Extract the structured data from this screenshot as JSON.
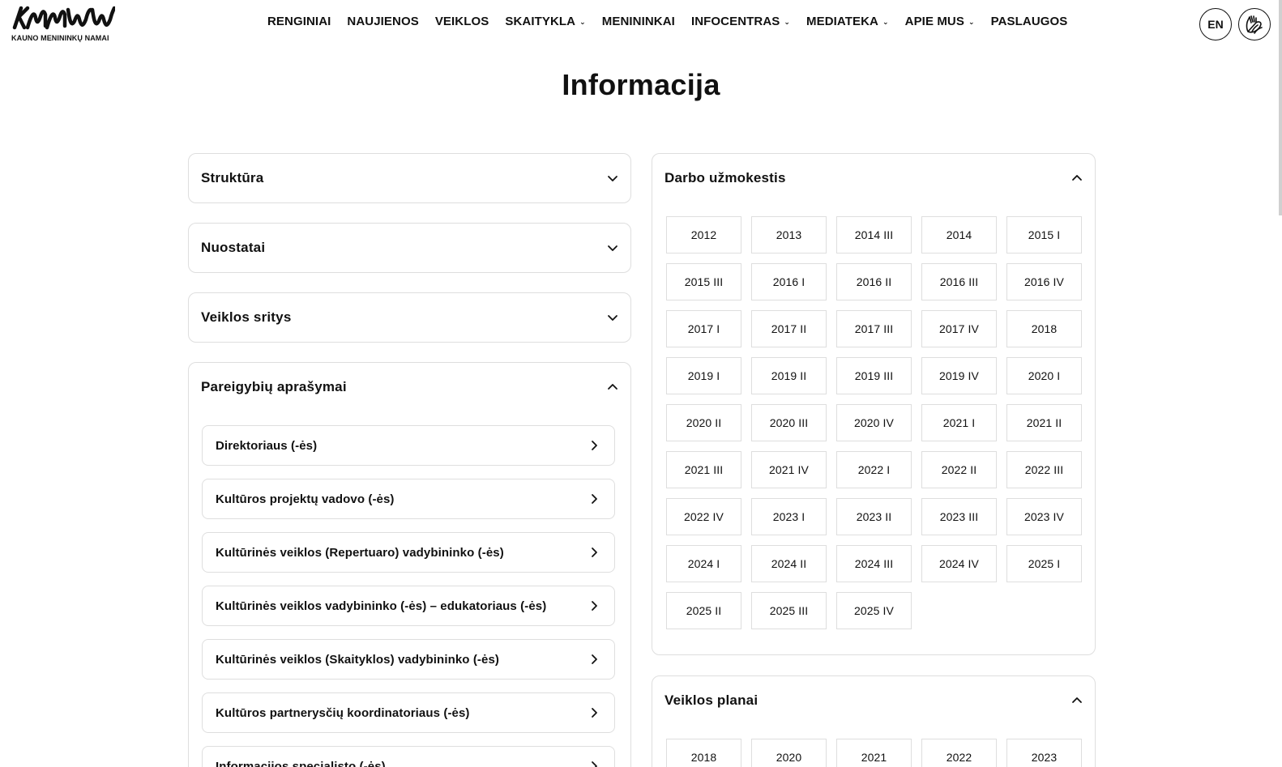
{
  "brand": {
    "logo_text": "KAUNO MENININKŲ NAMAI"
  },
  "nav": [
    {
      "label": "RENGINIAI",
      "dropdown": false
    },
    {
      "label": "NAUJIENOS",
      "dropdown": false
    },
    {
      "label": "VEIKLOS",
      "dropdown": false
    },
    {
      "label": "SKAITYKLA",
      "dropdown": true
    },
    {
      "label": "MENININKAI",
      "dropdown": false
    },
    {
      "label": "INFOCENTRAS",
      "dropdown": true
    },
    {
      "label": "MEDIATEKA",
      "dropdown": true
    },
    {
      "label": "APIE MUS",
      "dropdown": true
    },
    {
      "label": "PASLAUGOS",
      "dropdown": false
    }
  ],
  "header": {
    "lang_label": "EN"
  },
  "page": {
    "title": "Informacija"
  },
  "left": {
    "sections": [
      {
        "title": "Struktūra",
        "expanded": false
      },
      {
        "title": "Nuostatai",
        "expanded": false
      },
      {
        "title": "Veiklos sritys",
        "expanded": false
      },
      {
        "title": "Pareigybių aprašymai",
        "expanded": true
      }
    ],
    "positions": [
      "Direktoriaus (-ės)",
      "Kultūros projektų vadovo (-ės)",
      "Kultūrinės veiklos (Repertuaro) vadybininko (-ės)",
      "Kultūrinės veiklos vadybininko (-ės) – edukatoriaus (-ės)",
      "Kultūrinės veiklos (Skaityklos) vadybininko (-ės)",
      "Kultūros partnerysčių koordinatoriaus (-ės)",
      "Informacijos specialisto (-ės)"
    ]
  },
  "right": {
    "salary": {
      "title": "Darbo užmokestis",
      "expanded": true,
      "items": [
        "2012",
        "2013",
        "2014 III",
        "2014",
        "2015 I",
        "2015 III",
        "2016 I",
        "2016 II",
        "2016 III",
        "2016 IV",
        "2017 I",
        "2017 II",
        "2017 III",
        "2017 IV",
        "2018",
        "2019 I",
        "2019 II",
        "2019 III",
        "2019 IV",
        "2020 I",
        "2020 II",
        "2020 III",
        "2020 IV",
        "2021 I",
        "2021 II",
        "2021 III",
        "2021 IV",
        "2022 I",
        "2022 II",
        "2022 III",
        "2022 IV",
        "2023 I",
        "2023 II",
        "2023 III",
        "2023 IV",
        "2024 I",
        "2024 II",
        "2024 III",
        "2024 IV",
        "2025 I",
        "2025 II",
        "2025 III",
        "2025 IV"
      ]
    },
    "plans": {
      "title": "Veiklos planai",
      "expanded": true,
      "items": [
        "2018",
        "2020",
        "2021",
        "2022",
        "2023"
      ]
    }
  }
}
